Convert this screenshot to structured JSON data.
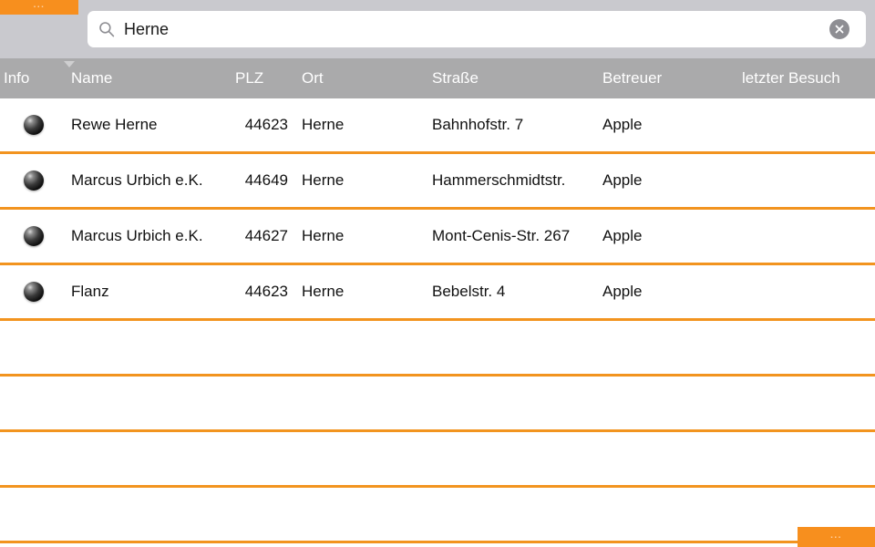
{
  "colors": {
    "accent_orange": "#f78f1e",
    "row_divider": "#f2941f",
    "toolbar_gray": "#c9c9ce",
    "header_gray": "#aaaaab",
    "clear_button_gray": "#8e8e93"
  },
  "top_tab": {
    "label": "...",
    "icon": "ellipsis-icon"
  },
  "bottom_tab": {
    "label": "...",
    "icon": "ellipsis-icon"
  },
  "search": {
    "value": "Herne",
    "placeholder": "",
    "icon": "search-icon",
    "clear_icon": "clear-circle-icon"
  },
  "table": {
    "sort": {
      "column": "Name",
      "direction": "descending",
      "icon": "triangle-down-icon"
    },
    "columns": [
      {
        "key": "info",
        "label": "Info"
      },
      {
        "key": "name",
        "label": "Name"
      },
      {
        "key": "plz",
        "label": "PLZ"
      },
      {
        "key": "ort",
        "label": "Ort"
      },
      {
        "key": "strasse",
        "label": "Straße"
      },
      {
        "key": "betreuer",
        "label": "Betreuer"
      },
      {
        "key": "besuch",
        "label": "letzter Besuch"
      }
    ],
    "rows": [
      {
        "info_icon": "sphere-icon",
        "name": "Rewe Herne",
        "plz": "44623",
        "ort": "Herne",
        "strasse": "Bahnhofstr. 7",
        "betreuer": "Apple",
        "besuch": ""
      },
      {
        "info_icon": "sphere-icon",
        "name": "Marcus Urbich e.K.",
        "plz": "44649",
        "ort": "Herne",
        "strasse": "Hammerschmidtstr.",
        "betreuer": "Apple",
        "besuch": ""
      },
      {
        "info_icon": "sphere-icon",
        "name": "Marcus Urbich e.K.",
        "plz": "44627",
        "ort": "Herne",
        "strasse": "Mont-Cenis-Str. 267",
        "betreuer": "Apple",
        "besuch": ""
      },
      {
        "info_icon": "sphere-icon",
        "name": "Flanz",
        "plz": "44623",
        "ort": "Herne",
        "strasse": "Bebelstr. 4",
        "betreuer": "Apple",
        "besuch": ""
      }
    ],
    "empty_row_count": 4
  }
}
